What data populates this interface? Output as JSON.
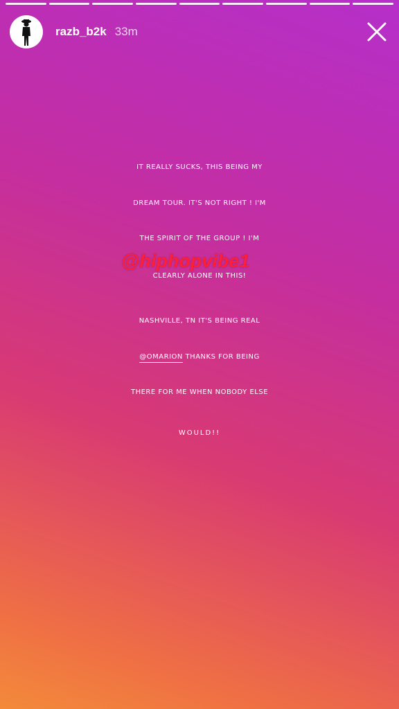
{
  "progress": {
    "segments": 9,
    "completed": 9
  },
  "header": {
    "username": "razb_b2k",
    "timestamp": "33m",
    "avatar_icon": "person-silhouette-icon",
    "close_icon": "close-icon"
  },
  "story": {
    "lines": [
      "IT REALLY SUCKS, THIS BEING MY",
      "DREAM TOUR. IT'S NOT RIGHT !  I'M",
      "THE SPIRIT OF THE GROUP ! I'M",
      "CLEARLY ALONE IN THIS!",
      "NASHVILLE, TN IT'S BEING REAL",
      "THANKS FOR BEING",
      "THERE FOR ME WHEN NOBODY ELSE",
      "WOULD!!"
    ],
    "mention": "@OMARION"
  },
  "watermark": "@hiphopvibe1",
  "colors": {
    "gradient_top": "#b52fc9",
    "gradient_bottom": "#f38a3a",
    "watermark": "#ff1f3a"
  }
}
